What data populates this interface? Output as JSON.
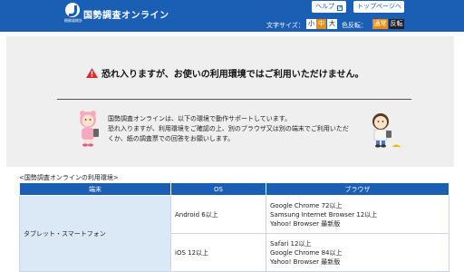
{
  "header": {
    "logo_sub": "総務省統計",
    "site_title": "国勢調査オンライン",
    "help_label": "ヘルプ",
    "top_label": "トップページへ",
    "font_size_label": "文字サイズ：",
    "font_sizes": [
      "小",
      "中",
      "大"
    ],
    "color_label": "色反転：",
    "color_modes": [
      "通常",
      "反転"
    ],
    "brand_color": "#1a5fb4",
    "accent_color": "#f08c00"
  },
  "warning": {
    "message": "恐れ入りますが、お使いの利用環境ではご利用いただけません。",
    "info_lines": [
      "国勢調査オンラインは、以下の環境で動作サポートしています。",
      "恐れ入りますが、利用環境をご確認の上、別のブラウザ又は別の端末でご利用いただ",
      "くか、紙の調査票での回答をお願いします。"
    ]
  },
  "env": {
    "title": "<国勢調査オンラインの利用環境>",
    "headers": [
      "端末",
      "OS",
      "ブラウザ"
    ],
    "device": "タブレット・スマートフォン",
    "rows": [
      {
        "os": "Android 6以上",
        "browsers": [
          "Google Chrome 72以上",
          "Samsung Internet Browser 12以上",
          "Yahoo! Browser 最新版"
        ]
      },
      {
        "os": "iOS 12以上",
        "browsers": [
          "Safari 12以上",
          "Google Chrome 84以上",
          "Yahoo! Browser 最新版"
        ]
      }
    ]
  }
}
